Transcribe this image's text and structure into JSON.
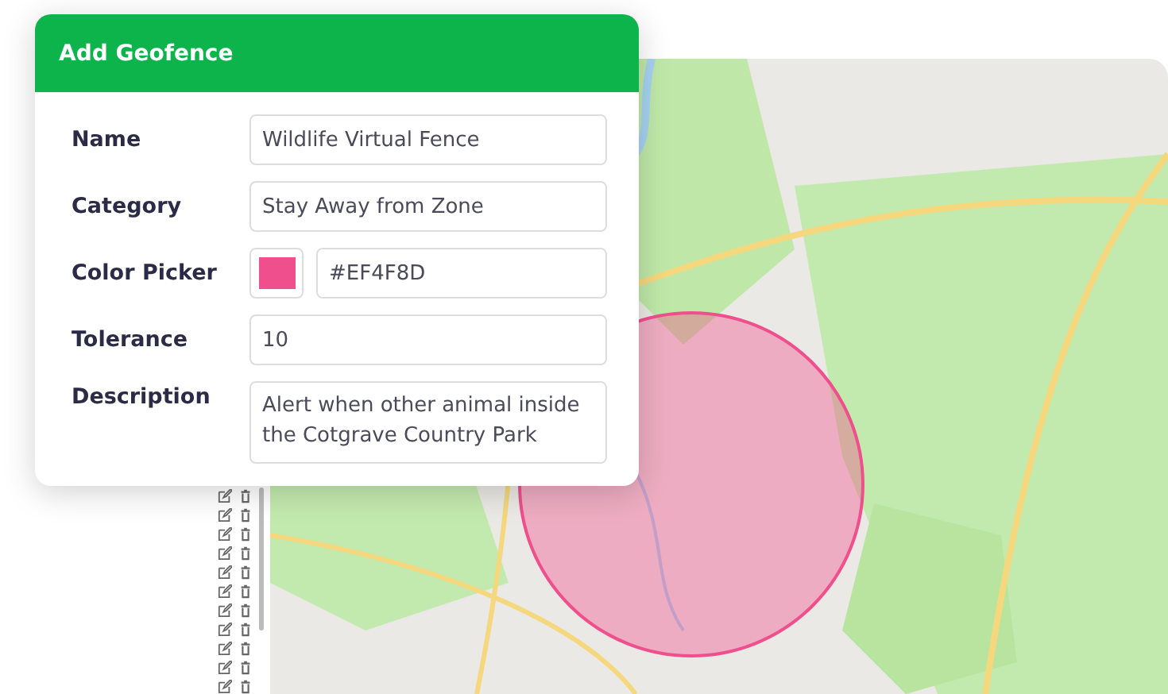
{
  "dialog": {
    "title": "Add Geofence",
    "fields": [
      {
        "kind": "text",
        "label": "Name",
        "value": "Wildlife Virtual Fence"
      },
      {
        "kind": "text",
        "label": "Category",
        "value": "Stay Away from Zone"
      },
      {
        "kind": "color",
        "label": "Color Picker",
        "value": "#EF4F8D",
        "color": "#ef4f8d"
      },
      {
        "kind": "text",
        "label": "Tolerance",
        "value": "10"
      },
      {
        "kind": "textarea",
        "label": "Description",
        "value": "Alert when other animal inside the Cotgrave Country Park"
      }
    ]
  }
}
